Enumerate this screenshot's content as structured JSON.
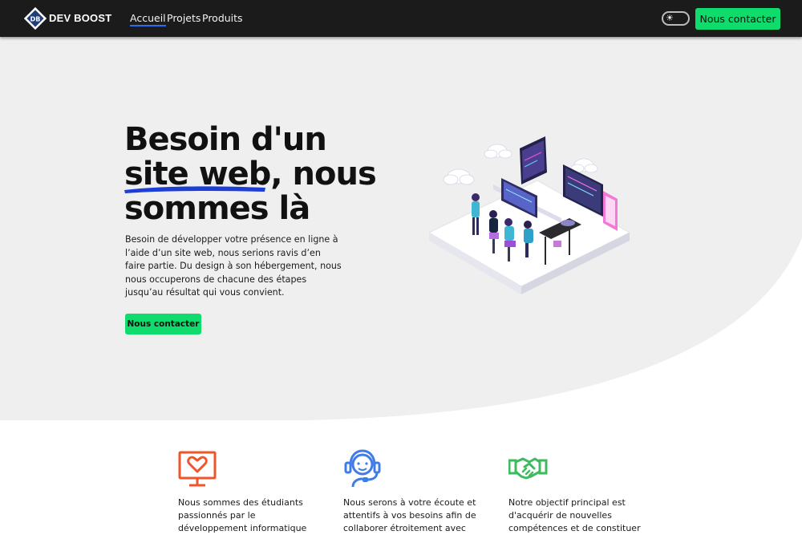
{
  "nav": {
    "brand": "DEV BOOST",
    "logo_text": "DB",
    "links": [
      {
        "label": "Accueil",
        "active": true
      },
      {
        "label": "Projets",
        "active": false
      },
      {
        "label": "Produits",
        "active": false
      }
    ],
    "theme_toggle_icon": "sun-icon",
    "contact_button": "Nous contacter"
  },
  "hero": {
    "title_line1": "Besoin d'un",
    "title_highlight": "site web",
    "title_line2_rest": ", nous",
    "title_line3": "sommes là",
    "text": "Besoin de développer votre présence en ligne à l’aide d’un site web, nous serions ravis d’en faire partie. Du design à son hébergement, nous nous occuperons de chacune des étapes jusqu’au résultat qui vous convient.",
    "button": "Nous contacter",
    "illustration": "isometric-team-workspace-illustration"
  },
  "features": [
    {
      "icon": "heart-monitor-icon",
      "color": "#f0552a",
      "text": "Nous sommes des étudiants passionnés par le développement informatique"
    },
    {
      "icon": "support-headset-icon",
      "color": "#3f7ce8",
      "text": "Nous serons à votre écoute et attentifs à vos besoins afin de collaborer étroitement avec"
    },
    {
      "icon": "handshake-icon",
      "color": "#3dbb5e",
      "text": "Notre objectif principal est d'acquérir de nouvelles compétences et de constituer"
    }
  ],
  "colors": {
    "navbar": "#1b1b1b",
    "accent_green": "#0fdc6d",
    "accent_blue": "#2c6cf0",
    "hero_bg": "#efefef"
  }
}
